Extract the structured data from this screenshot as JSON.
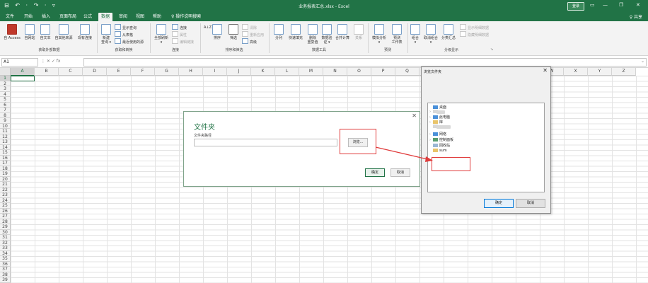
{
  "titlebar": {
    "quick_access": "⊟ ↶ · ↷ · ▿",
    "doc_title": "业务报表汇总.xlsx - Excel",
    "login_label": "登录",
    "ribbon_display_icon": "ribbon-display-icon",
    "minimize": "—",
    "restore": "❐",
    "close": "✕"
  },
  "tabs": [
    "文件",
    "开始",
    "插入",
    "页面布局",
    "公式",
    "数据",
    "审阅",
    "视图",
    "帮助"
  ],
  "tell_me": "♀ 操作说明搜索",
  "share_label": "♀ 共享",
  "ribbon": {
    "get_external": {
      "buttons": [
        "自 Access",
        "自网站",
        "自文本",
        "自其他来源",
        "现有连接"
      ],
      "group_label": "获取外部数据"
    },
    "get_transform": {
      "new_query": "新建\n查询 ▾",
      "small": [
        "显示查询",
        "从表格",
        "最近使用的源"
      ],
      "group_label": "获取和转换"
    },
    "connections": {
      "refresh_all": "全部刷新\n▾",
      "small": [
        "连接",
        "属性",
        "编辑链接"
      ],
      "group_label": "连接"
    },
    "sort_filter": {
      "sort_az": "A↓Z",
      "sort": "排序",
      "filter": "筛选",
      "small": [
        "清除",
        "重新应用",
        "高级"
      ],
      "group_label": "排序和筛选"
    },
    "data_tools": {
      "buttons": [
        "分列",
        "快速填充",
        "删除\n重复值",
        "数据验\n证 ▾",
        "合并计算",
        "关系"
      ],
      "group_label": "数据工具"
    },
    "forecast": {
      "buttons": [
        "模拟分析\n▾",
        "预测\n工作表"
      ],
      "group_label": "预测"
    },
    "outline": {
      "buttons": [
        "组合\n▾",
        "取消组合\n▾",
        "分类汇总"
      ],
      "small": [
        "显示明细数据",
        "隐藏明细数据"
      ],
      "group_label": "分级显示"
    }
  },
  "formula_bar": {
    "name_box": "A1",
    "fx_symbols": "⋮   ✕   ✓   fx",
    "formula": ""
  },
  "grid": {
    "columns": [
      "A",
      "B",
      "C",
      "D",
      "E",
      "F",
      "G",
      "H",
      "I",
      "J",
      "K",
      "L",
      "M",
      "N",
      "O",
      "P",
      "Q",
      "R",
      "S",
      "T",
      "U",
      "V",
      "W",
      "X",
      "Y",
      "Z"
    ],
    "rows": [
      "1",
      "2",
      "3",
      "4",
      "5",
      "6",
      "7",
      "8",
      "9",
      "10",
      "11",
      "12",
      "13",
      "14",
      "15",
      "16",
      "17",
      "18",
      "19",
      "20",
      "21",
      "22",
      "23",
      "24",
      "25",
      "26",
      "27",
      "28",
      "29",
      "30",
      "31",
      "32",
      "33",
      "34",
      "35",
      "36",
      "37",
      "38",
      "39"
    ]
  },
  "folder_dialog": {
    "title": "文件夹",
    "path_label": "文件夹路径",
    "path_value": "",
    "browse_label": "浏览...",
    "ok_label": "确定",
    "cancel_label": "取消",
    "close": "✕"
  },
  "browse_dialog": {
    "title": "浏览文件夹",
    "close": "✕",
    "tree": [
      {
        "label": "桌面",
        "icon": "desktop-icon"
      },
      {
        "label": "",
        "icon": "user-folder-icon"
      },
      {
        "label": "此电脑",
        "icon": "computer-icon"
      },
      {
        "label": "库",
        "icon": "library-icon"
      },
      {
        "label": "",
        "icon": "folder-icon"
      },
      {
        "label": "网络",
        "icon": "network-icon"
      },
      {
        "label": "控制面板",
        "icon": "control-panel-icon"
      },
      {
        "label": "回收站",
        "icon": "recycle-bin-icon"
      },
      {
        "label": "sum",
        "icon": "folder-icon"
      }
    ],
    "ok_label": "确定",
    "cancel_label": "取消"
  },
  "colors": {
    "accent": "#217346",
    "annotation": "#e03b3b"
  }
}
